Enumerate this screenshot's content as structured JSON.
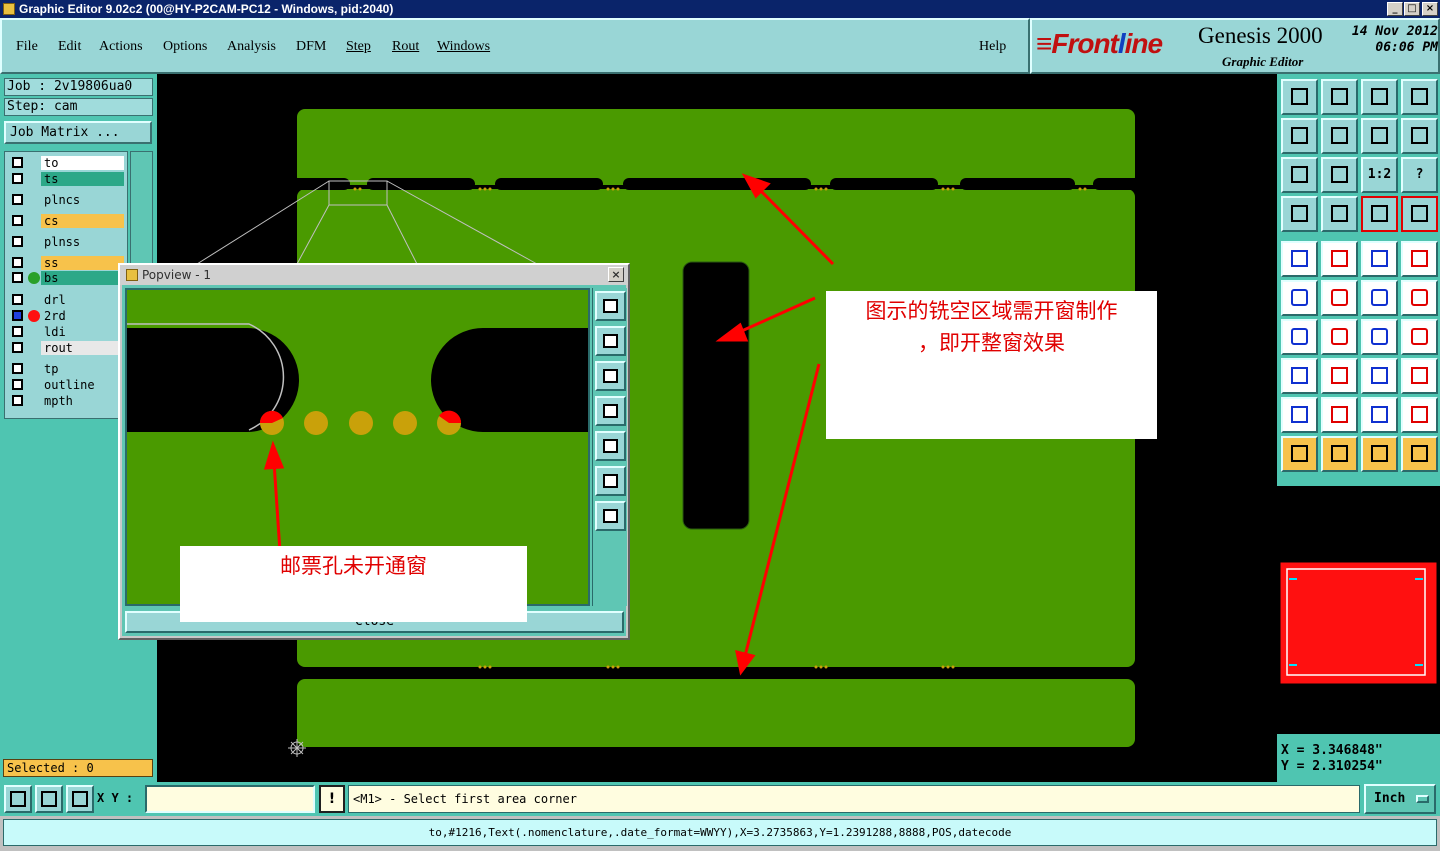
{
  "window": {
    "title": "Graphic Editor 9.02c2 (00@HY-P2CAM-PC12 - Windows, pid:2040)",
    "controls": [
      "_",
      "□",
      "×"
    ]
  },
  "menu": {
    "items": [
      {
        "label": "File"
      },
      {
        "label": "Edit"
      },
      {
        "label": "Actions"
      },
      {
        "label": "Options"
      },
      {
        "label": "Analysis"
      },
      {
        "label": "DFM"
      },
      {
        "label": "Step"
      },
      {
        "label": "Rout"
      },
      {
        "label": "Windows"
      }
    ],
    "help": "Help"
  },
  "brand": {
    "logo_prefix": "Front",
    "logo_ring": "l",
    "logo_suffix": "ine",
    "product": "Genesis 2000",
    "subtitle": "Graphic Editor",
    "date": "14 Nov 2012",
    "time": "06:06 PM"
  },
  "job": {
    "job_line": "Job : 2v19806ua0",
    "step_line": "Step: cam",
    "matrix_button": "Job Matrix ..."
  },
  "layers": [
    {
      "name": "to",
      "color": "#ffffff",
      "checked": false,
      "dot": null
    },
    {
      "name": "ts",
      "color": "#2ca888",
      "checked": false,
      "dot": null
    },
    {
      "name": "plncs",
      "color": "#99d6d6",
      "checked": false,
      "dot": null
    },
    {
      "name": "cs",
      "color": "#f7c24b",
      "checked": false,
      "dot": null
    },
    {
      "name": "plnss",
      "color": "#99d6d6",
      "checked": false,
      "dot": null
    },
    {
      "name": "ss",
      "color": "#f7c24b",
      "checked": false,
      "dot": null
    },
    {
      "name": "bs",
      "color": "#2ca888",
      "checked": false,
      "dot": "#2aa02a"
    },
    {
      "name": "drl",
      "color": "#99d6d6",
      "checked": false,
      "dot": null
    },
    {
      "name": "2rd",
      "color": "#99d6d6",
      "checked": true,
      "dot": "#ff1010"
    },
    {
      "name": "ldi",
      "color": "#99d6d6",
      "checked": false,
      "dot": null
    },
    {
      "name": "rout",
      "color": "#e8e8e8",
      "checked": false,
      "dot": null
    },
    {
      "name": "tp",
      "color": "#99d6d6",
      "checked": false,
      "dot": null
    },
    {
      "name": "outline",
      "color": "#99d6d6",
      "checked": false,
      "dot": null
    },
    {
      "name": "mpth",
      "color": "#99d6d6",
      "checked": false,
      "dot": null
    }
  ],
  "selected": "Selected : 0",
  "popview": {
    "title": "Popview - 1",
    "close_label": "Close",
    "annotation": "邮票孔未开通窗"
  },
  "annotation_main": {
    "line1": "图示的铣空区域需开窗制作",
    "line2": "，即开整窗效果"
  },
  "toolbar_right": {
    "tool_icons": [
      "zoom-home-icon",
      "zoom-in-icon",
      "zoom-home-alt-icon",
      "split-view-icon",
      "pan-left-icon",
      "pan-right-icon",
      "swap-icon",
      "rotate-icon",
      "fit-icon",
      "center-icon",
      "scale-1-2-icon",
      "query-icon",
      "settings-icon",
      "grid-icon",
      "measure-active-icon",
      "measure2-active-icon",
      "move-icon",
      "draw-line-icon",
      "ruler-icon",
      "pad-icon",
      "connect-icon",
      "cross-icon",
      "edge-icon",
      "edge2-icon",
      "angle-icon",
      "diagonal-icon",
      "arc-icon",
      "flip-icon",
      "move-pad-icon",
      "line-icon",
      "box-measure-icon",
      "shapes-icon",
      "triangle-icon",
      "triangle2-icon",
      "triangle3-icon",
      "triangle4-icon",
      "pointer-icon",
      "pointer-select-icon",
      "pointer-area-icon",
      "route-icon"
    ],
    "scale_label": "1:2",
    "query_label": "?"
  },
  "coords": {
    "x": "X = 3.346848\"",
    "y": "Y = 2.310254\""
  },
  "command": {
    "xy_label": "X Y :",
    "xy_value": "",
    "warn_label": "!",
    "prompt": "<M1> - Select first area corner",
    "units": "Inch"
  },
  "status": "to,#1216,Text(.nomenclature,.date_format=WWYY),X=3.2735863,Y=1.2391288,8888,POS,datecode",
  "colors": {
    "board_green": "#4a9a00",
    "slot_black": "#000000",
    "pad_gold": "#c9a10a",
    "pad_red": "#ff0000",
    "arrow_red": "#ff0000"
  }
}
